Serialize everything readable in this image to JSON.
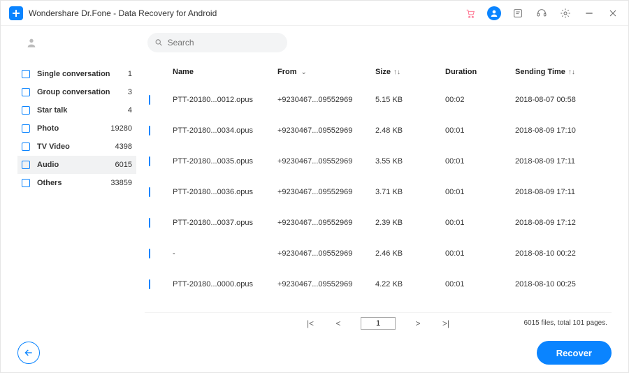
{
  "window": {
    "title": "Wondershare Dr.Fone - Data Recovery for Android"
  },
  "search": {
    "placeholder": "Search"
  },
  "sidebar": {
    "items": [
      {
        "label": "Single conversation",
        "count": "1"
      },
      {
        "label": "Group conversation",
        "count": "3"
      },
      {
        "label": "Star talk",
        "count": "4"
      },
      {
        "label": "Photo",
        "count": "19280"
      },
      {
        "label": "TV Video",
        "count": "4398"
      },
      {
        "label": "Audio",
        "count": "6015",
        "active": true
      },
      {
        "label": "Others",
        "count": "33859"
      }
    ]
  },
  "table": {
    "headers": {
      "name": "Name",
      "from": "From",
      "size": "Size",
      "duration": "Duration",
      "sending_time": "Sending Time"
    },
    "rows": [
      {
        "name": "PTT-20180...0012.opus",
        "from": "+9230467...09552969",
        "size": "5.15 KB",
        "duration": "00:02",
        "sending_time": "2018-08-07 00:58"
      },
      {
        "name": "PTT-20180...0034.opus",
        "from": "+9230467...09552969",
        "size": "2.48 KB",
        "duration": "00:01",
        "sending_time": "2018-08-09 17:10"
      },
      {
        "name": "PTT-20180...0035.opus",
        "from": "+9230467...09552969",
        "size": "3.55 KB",
        "duration": "00:01",
        "sending_time": "2018-08-09 17:11"
      },
      {
        "name": "PTT-20180...0036.opus",
        "from": "+9230467...09552969",
        "size": "3.71 KB",
        "duration": "00:01",
        "sending_time": "2018-08-09 17:11"
      },
      {
        "name": "PTT-20180...0037.opus",
        "from": "+9230467...09552969",
        "size": "2.39 KB",
        "duration": "00:01",
        "sending_time": "2018-08-09 17:12"
      },
      {
        "name": "-",
        "from": "+9230467...09552969",
        "size": "2.46 KB",
        "duration": "00:01",
        "sending_time": "2018-08-10 00:22"
      },
      {
        "name": "PTT-20180...0000.opus",
        "from": "+9230467...09552969",
        "size": "4.22 KB",
        "duration": "00:01",
        "sending_time": "2018-08-10 00:25"
      }
    ]
  },
  "pager": {
    "current": "1",
    "summary": "6015 files, total 101 pages."
  },
  "footer": {
    "recover_label": "Recover"
  }
}
